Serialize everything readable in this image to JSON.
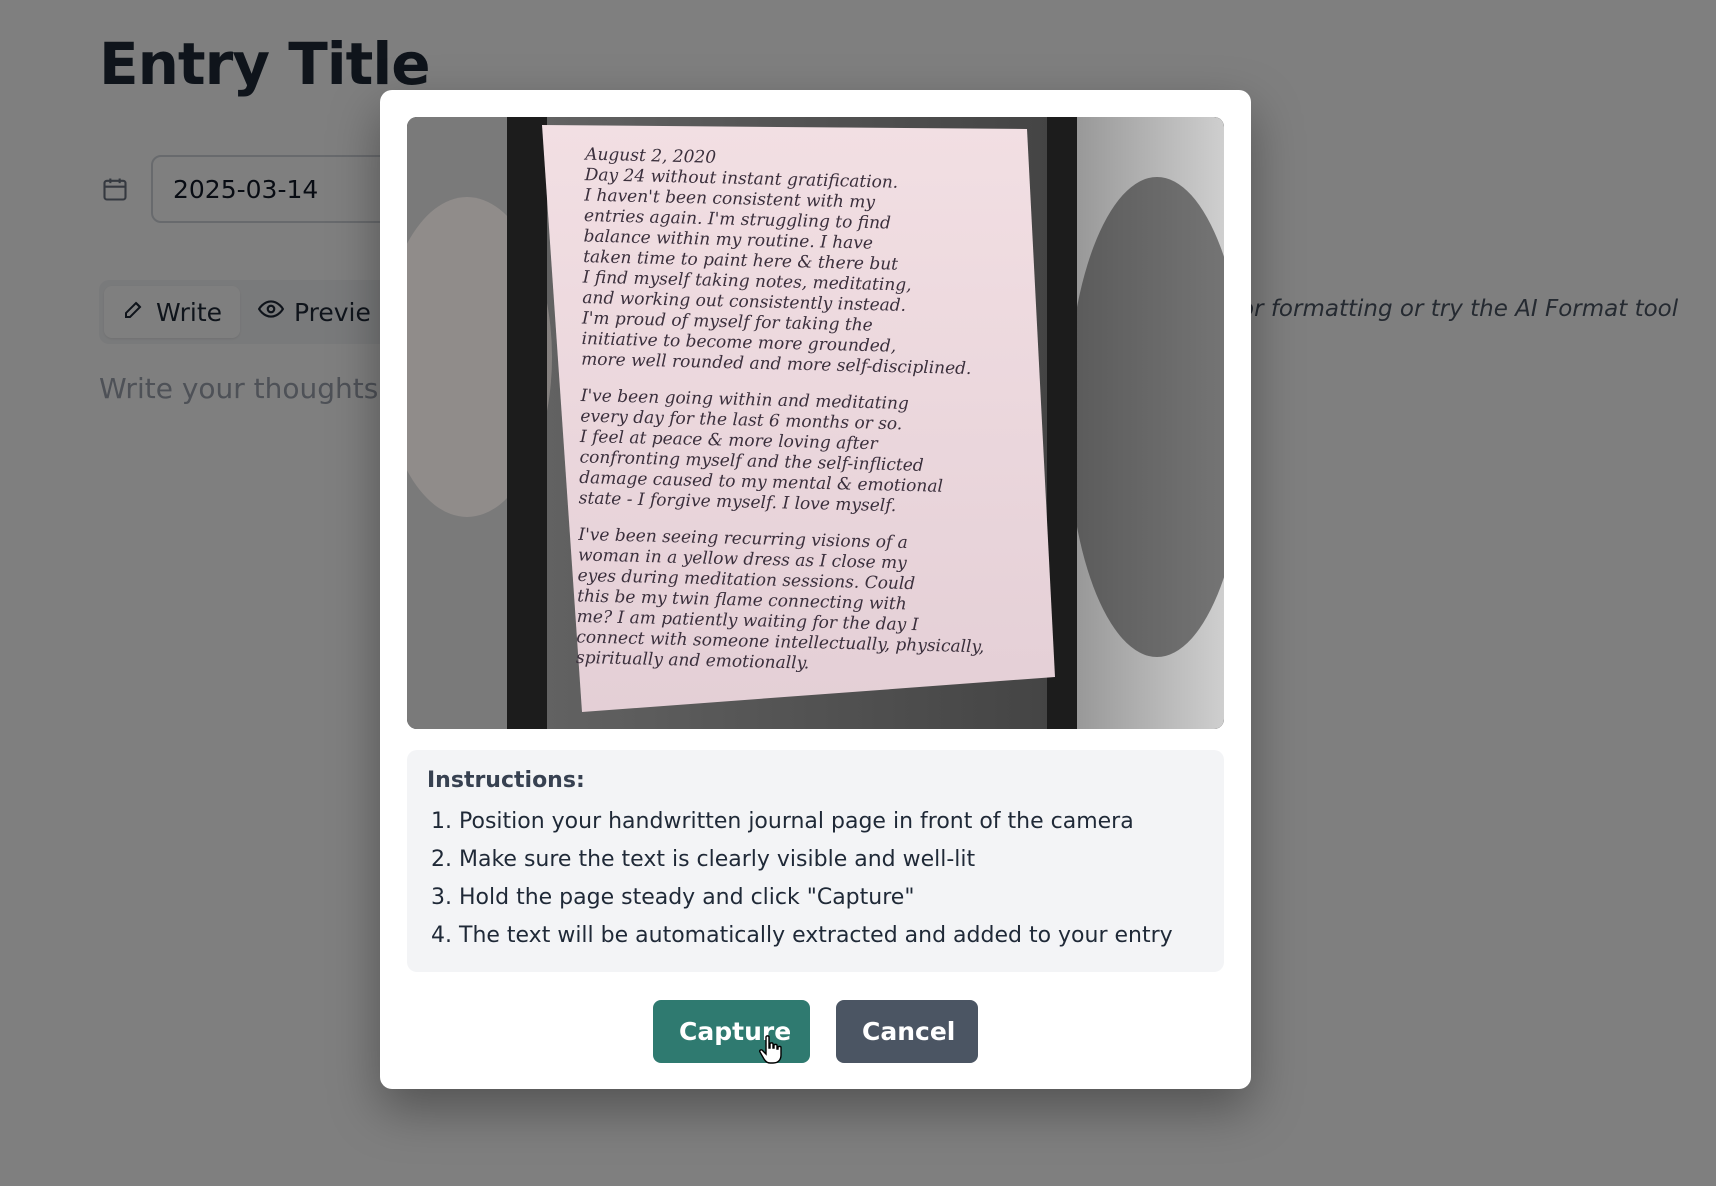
{
  "editor": {
    "title": "Entry Title",
    "date_value": "2025-03-14",
    "tabs": [
      {
        "label": "Write",
        "icon": "edit-icon",
        "active": true
      },
      {
        "label": "Previe",
        "icon": "eye-icon",
        "active": false
      }
    ],
    "hint": "or formatting or try the AI Format tool",
    "content_placeholder": "Write your thoughts"
  },
  "modal": {
    "camera_feed": {
      "handwritten_lines": [
        "August 2, 2020",
        "Day 24 without instant gratification.",
        "I haven't been consistent with my",
        "entries again. I'm struggling to find",
        "balance within my routine. I have",
        "taken time to paint here & there but",
        "I find myself taking notes, meditating,",
        "and working out consistently instead.",
        "I'm proud of myself for taking the",
        "initiative to become more grounded,",
        "more well rounded and more self-disciplined.",
        "I've been going within and meditating",
        "every day for the last 6 months or so.",
        "I feel at peace & more loving after",
        "confronting myself and the self-inflicted",
        "damage caused to my mental & emotional",
        "state - I forgive myself. I love myself.",
        "I've been seeing recurring visions of a",
        "woman in a yellow dress as I close my",
        "eyes during meditation sessions. Could",
        "this be my twin flame connecting with",
        "me? I am patiently waiting for the day I",
        "connect with someone intellectually, physically,",
        "spiritually and emotionally."
      ]
    },
    "instructions": {
      "title": "Instructions:",
      "steps": [
        "Position your handwritten journal page in front of the camera",
        "Make sure the text is clearly visible and well-lit",
        "Hold the page steady and click \"Capture\"",
        "The text will be automatically extracted and added to your entry"
      ]
    },
    "buttons": {
      "capture_label": "Capture",
      "cancel_label": "Cancel"
    }
  },
  "colors": {
    "overlay": "#808080",
    "capture_button": "#2f7a70",
    "cancel_button": "#4b5563",
    "instructions_bg": "#f3f4f6"
  }
}
